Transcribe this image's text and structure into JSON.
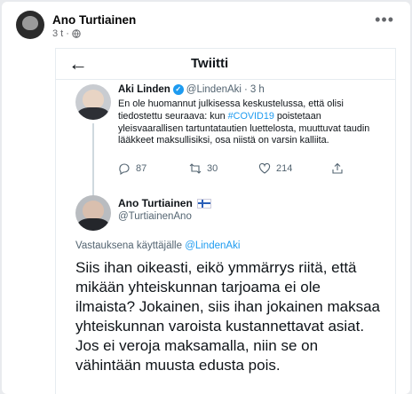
{
  "facebook_post": {
    "author": "Ano Turtiainen",
    "time": "3 t",
    "visibility_icon": "globe-icon",
    "more_icon": "more-options-icon"
  },
  "twitter": {
    "header_title": "Twiitti",
    "back_icon": "back-arrow-icon",
    "original_tweet": {
      "name": "Aki Linden",
      "handle": "@LindenAki",
      "time": "3 h",
      "text_before": "En ole huomannut julkisessa keskustelussa, että olisi tiedostettu seuraava: kun ",
      "hashtag": "#COVID19",
      "text_after": " poistetaan yleisvaarallisen tartuntatautien luettelosta, muuttuvat taudin lääkkeet maksullisiksi, osa niistä on varsin kalliita.",
      "replies": "87",
      "retweets": "30",
      "likes": "214"
    },
    "reply_tweet": {
      "name": "Ano Turtiainen",
      "handle": "@TurtiainenAno",
      "reply_label": "Vastauksena käyttäjälle",
      "reply_to": "@LindenAki",
      "text": "Siis ihan oikeasti, eikö ymmärrys riitä, että mikään yhteiskunnan tarjoama ei ole ilmaista? Jokainen, siis ihan jokainen maksaa yhteiskunnan varoista kustannettavat asiat. Jos ei veroja maksamalla, niin se on vähintään muusta edusta pois."
    }
  },
  "colors": {
    "accent": "#1d9bf0",
    "text": "#0f1419",
    "muted": "#536471"
  }
}
